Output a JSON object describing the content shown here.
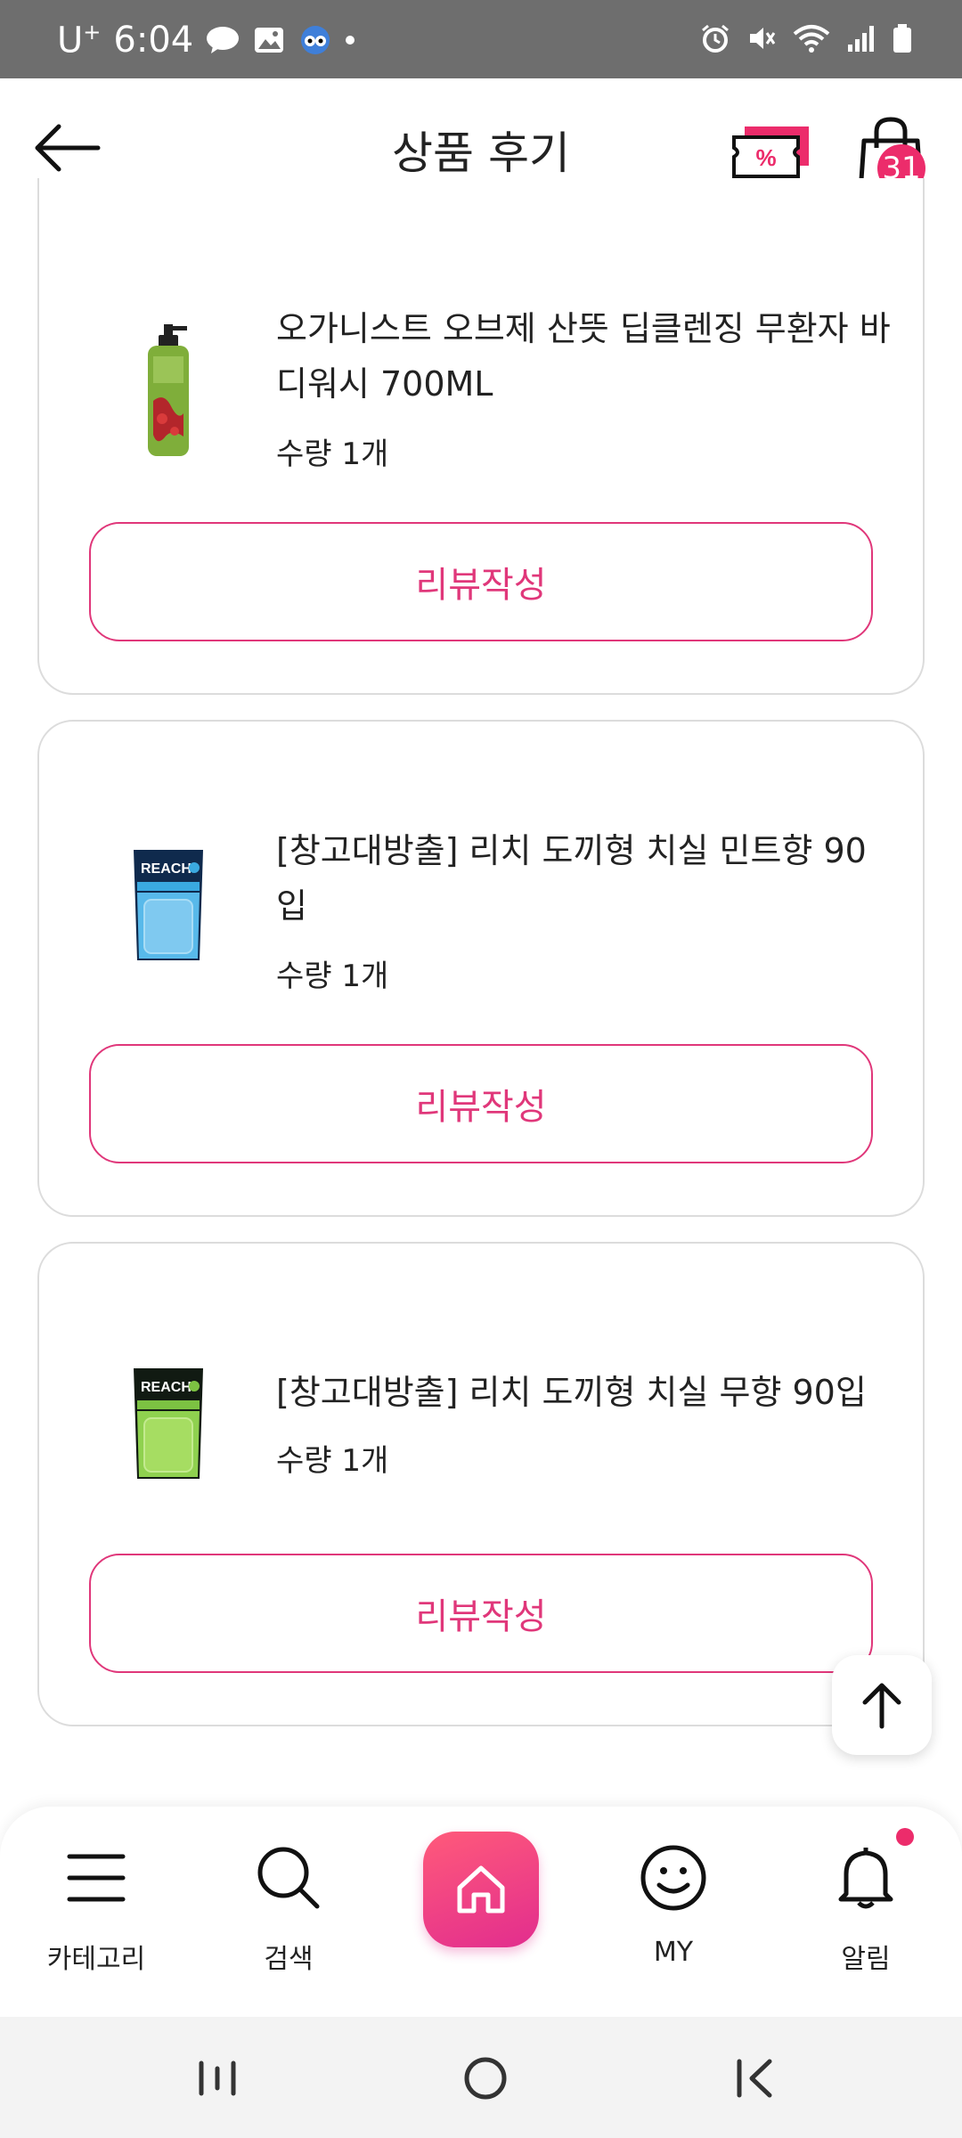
{
  "status_bar": {
    "carrier": "U",
    "carrier_sup": "+",
    "time": "6:04"
  },
  "header": {
    "title": "상품 후기",
    "cart_count": "31"
  },
  "products": [
    {
      "name": "오가니스트 오브제 산뜻 딥클렌징 무환자 바디워시 700ML",
      "quantity": "수량 1개",
      "button_label": "리뷰작성"
    },
    {
      "name": "[창고대방출] 리치 도끼형 치실 민트향 90입",
      "quantity": "수량 1개",
      "button_label": "리뷰작성"
    },
    {
      "name": "[창고대방출] 리치 도끼형 치실 무향 90입",
      "quantity": "수량 1개",
      "button_label": "리뷰작성"
    }
  ],
  "bottom_nav": {
    "category": "카테고리",
    "search": "검색",
    "my": "MY",
    "notifications": "알림"
  },
  "colors": {
    "accent": "#e0377a",
    "badge": "#ec2c6b"
  }
}
